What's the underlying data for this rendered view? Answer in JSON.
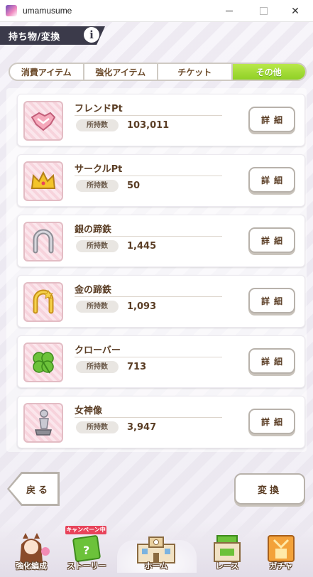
{
  "window": {
    "title": "umamusume"
  },
  "header": {
    "title": "持ち物/変換",
    "info_icon": "i"
  },
  "tabs": [
    {
      "label": "消費アイテム",
      "active": false
    },
    {
      "label": "強化アイテム",
      "active": false
    },
    {
      "label": "チケット",
      "active": false
    },
    {
      "label": "その他",
      "active": true
    }
  ],
  "owned_label": "所持数",
  "detail_label": "詳細",
  "items": [
    {
      "name": "フレンドPt",
      "owned": "103,011",
      "icon": "handshake-icon"
    },
    {
      "name": "サークルPt",
      "owned": "50",
      "icon": "crown-icon"
    },
    {
      "name": "銀の蹄鉄",
      "owned": "1,445",
      "icon": "silver-horseshoe-icon"
    },
    {
      "name": "金の蹄鉄",
      "owned": "1,093",
      "icon": "gold-horseshoe-icon"
    },
    {
      "name": "クローバー",
      "owned": "713",
      "icon": "clover-icon"
    },
    {
      "name": "女神像",
      "owned": "3,947",
      "icon": "goddess-statue-icon"
    }
  ],
  "buttons": {
    "back": "戻る",
    "convert": "変換"
  },
  "nav": {
    "campaign_badge": "キャンペーン中",
    "items": [
      {
        "label": "強化編成",
        "icon": "character-icon"
      },
      {
        "label": "ストーリー",
        "icon": "story-book-icon"
      },
      {
        "label": "ホーム",
        "icon": "home-building-icon"
      },
      {
        "label": "レース",
        "icon": "race-icon"
      },
      {
        "label": "ガチャ",
        "icon": "gacha-icon"
      }
    ]
  },
  "colors": {
    "active_tab": "#8fd026",
    "text_brown": "#5a3d24",
    "header_ribbon": "#3b3a4a",
    "thumb_pink": "#f7d3dc"
  }
}
